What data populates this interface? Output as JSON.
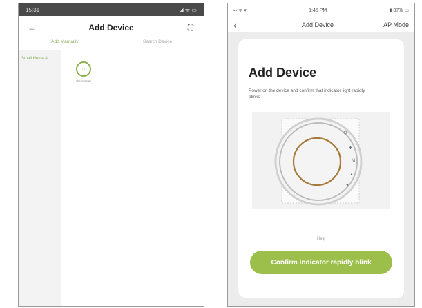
{
  "left": {
    "status": {
      "time": "15:31",
      "icons": "◢ ᯤ ▭"
    },
    "header": {
      "back_icon": "←",
      "title": "Add Device",
      "scan_icon": "⛶"
    },
    "tabs": [
      {
        "label": "Add Manually"
      },
      {
        "label": "Search Device"
      }
    ],
    "category": {
      "label": "Small Home A"
    },
    "device": {
      "label": "thermostat",
      "icon": "thermostat-icon"
    }
  },
  "right": {
    "status": {
      "left": "▪▪ ᯤ ▾",
      "time": "1:45 PM",
      "right": "▮ 37% ▭"
    },
    "header": {
      "back_icon": "‹",
      "title": "Add Device",
      "mode": "AP Mode"
    },
    "card": {
      "title": "Add Device",
      "description": "Power on the device and confirm that indicator light rapidly blinks",
      "help": "Help",
      "confirm_label": "Confirm indicator rapidly blink"
    }
  },
  "colors": {
    "accent": "#9bbf4a",
    "ring": "#a67a3a"
  }
}
